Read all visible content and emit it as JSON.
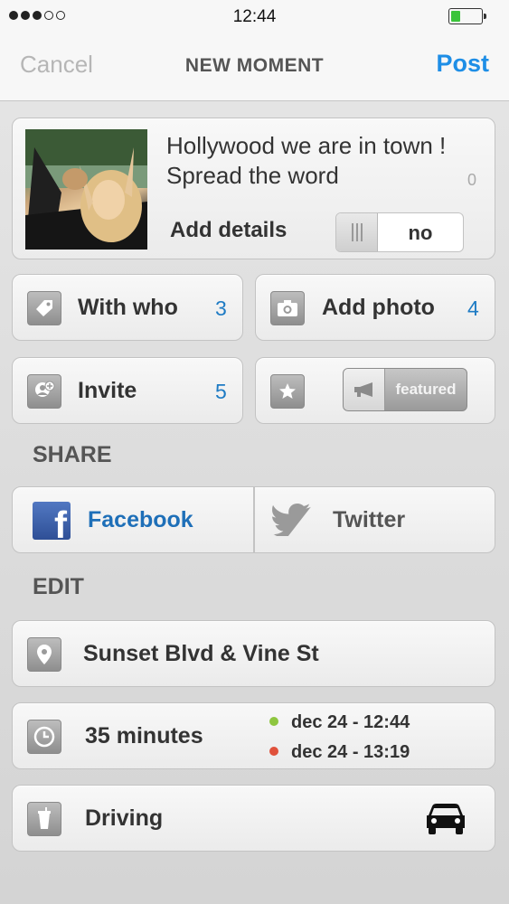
{
  "status_bar": {
    "time": "12:44",
    "signal_bars_filled": 3,
    "signal_bars_total": 5,
    "battery_level": 0.3,
    "battery_color": "#3ac43a"
  },
  "nav": {
    "cancel": "Cancel",
    "title": "NEW MOMENT",
    "post": "Post",
    "accent": "#1e8ee6"
  },
  "moment": {
    "text_line1": "Hollywood we are in town !",
    "text_line2": "Spread the word",
    "char_count": "0",
    "add_details_label": "Add details",
    "add_details_value": "no"
  },
  "actions": {
    "with_who": {
      "label": "With who",
      "count": "3",
      "icon": "tag-icon"
    },
    "add_photo": {
      "label": "Add photo",
      "count": "4",
      "icon": "camera-icon"
    },
    "invite": {
      "label": "Invite",
      "count": "5",
      "icon": "add-person-icon"
    },
    "featured": {
      "icon": "star-icon",
      "button_label": "featured",
      "button_icon": "megaphone-icon"
    }
  },
  "share": {
    "title": "SHARE",
    "facebook": "Facebook",
    "twitter": "Twitter",
    "facebook_color": "#1e6fb8"
  },
  "edit": {
    "title": "EDIT",
    "location": {
      "label": "Sunset Blvd & Vine St",
      "icon": "location-pin-icon"
    },
    "duration": {
      "label": "35 minutes",
      "icon": "clock-icon",
      "start": "dec 24 - 12:44",
      "end": "dec 24 - 13:19",
      "start_color": "#8ec63f",
      "end_color": "#e0513b"
    },
    "transport": {
      "label": "Driving",
      "icon": "drink-cup-icon",
      "mode_icon": "car-icon"
    }
  }
}
